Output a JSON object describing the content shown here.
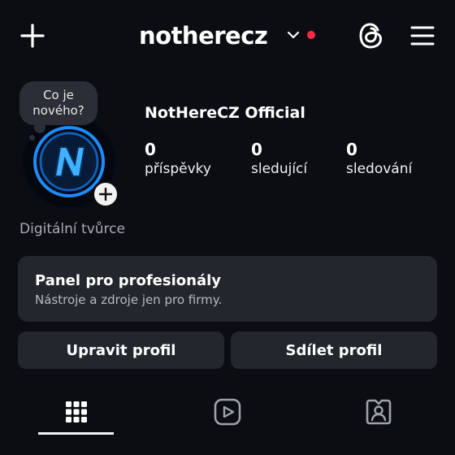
{
  "header": {
    "username": "notherecz",
    "icons": {
      "create": "plus-icon",
      "dropdown": "chevron-down-icon",
      "threads": "threads-icon",
      "menu": "hamburger-menu-icon"
    },
    "notification_color": "#ff2b45"
  },
  "profile": {
    "note_bubble": "Co je\nnového?",
    "display_name": "NotHereCZ Official",
    "stats": [
      {
        "value": "0",
        "label": "příspěvky"
      },
      {
        "value": "0",
        "label": "sledující"
      },
      {
        "value": "0",
        "label": "sledování"
      }
    ],
    "category": "Digitální tvůrce"
  },
  "pro_panel": {
    "title": "Panel pro profesionály",
    "subtitle": "Nástroje a zdroje jen pro firmy."
  },
  "buttons": {
    "edit": "Upravit profil",
    "share": "Sdílet profil"
  },
  "tabs": [
    {
      "icon": "grid-icon",
      "active": true
    },
    {
      "icon": "reels-icon",
      "active": false
    },
    {
      "icon": "tagged-icon",
      "active": false
    }
  ],
  "colors": {
    "background": "#0b0d12",
    "surface": "#23262d",
    "accent_logo": "#1e8cff"
  }
}
